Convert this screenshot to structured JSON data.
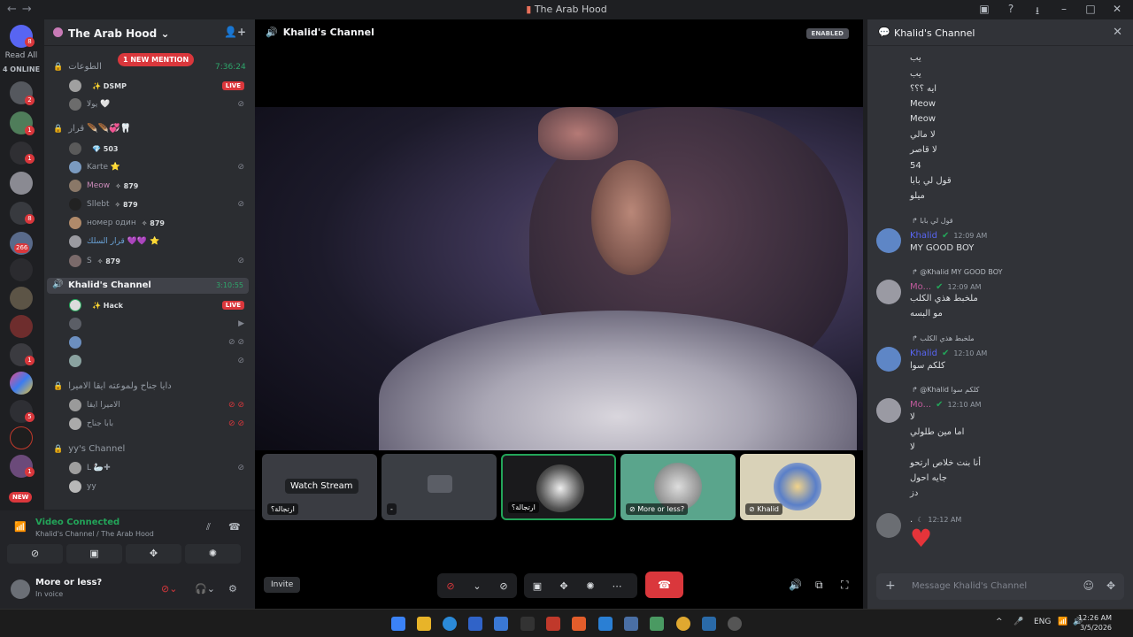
{
  "titlebar": {
    "title": "The Arab Hood",
    "back": "←",
    "forward": "→"
  },
  "rail": {
    "read_all": "Read All",
    "online": "4 ONLINE",
    "new_label": "NEW",
    "badges": [
      "8",
      "2",
      "1",
      "1",
      "8",
      "266",
      "1",
      "1",
      "5"
    ]
  },
  "server": {
    "name": "The Arab Hood"
  },
  "sidebar": {
    "new_mention": "1 NEW MENTION",
    "categories": [
      {
        "name": "الطوعات",
        "time": "7:36:24"
      },
      {
        "name": "قرار 🪶🪶💞🦷"
      },
      {
        "name": "Khalid's Channel",
        "time": "3:10:55"
      },
      {
        "name": "دايا جناح ولموعته ايقا الاميرا"
      },
      {
        "name": "yy's Channel"
      }
    ],
    "users": [
      {
        "name": "",
        "tag": "✨ DSMP",
        "live": "LIVE"
      },
      {
        "name": "يولا 🤍",
        "tag": ""
      },
      {
        "name": "",
        "tag": "💎 503"
      },
      {
        "name": "Karte ⭐",
        "tag": ""
      },
      {
        "name": "Meow",
        "tag": "✧ 879"
      },
      {
        "name": "Sllebt",
        "tag": "✧ 879"
      },
      {
        "name": "номер один",
        "tag": "✧ 879"
      },
      {
        "name": "قرار السلك 💜💜 ⭐",
        "tag": ""
      },
      {
        "name": "S",
        "tag": "✧ 879"
      },
      {
        "name": "",
        "tag": "✨ Hack",
        "live": "LIVE"
      },
      {
        "name": "",
        "tag": ""
      },
      {
        "name": "",
        "tag": ""
      },
      {
        "name": "",
        "tag": ""
      },
      {
        "name": "الاميرا ايقا",
        "tag": ""
      },
      {
        "name": "بابا جناح",
        "tag": ""
      },
      {
        "name": "L 🦢✚",
        "tag": ""
      },
      {
        "name": "yy",
        "tag": ""
      }
    ]
  },
  "voice": {
    "status": "Video Connected",
    "location": "Khalid's Channel / The Arab Hood"
  },
  "user": {
    "name": "More or less?",
    "status": "In voice"
  },
  "stage": {
    "channel": "Khalid's Channel",
    "enabled": "ENABLED",
    "tiles": [
      {
        "label": "ارتجالة؟",
        "overlay": "Watch Stream"
      },
      {
        "label": "-"
      },
      {
        "label": "ارتجالة؟"
      },
      {
        "label": "More or less?"
      },
      {
        "label": "Khalid"
      }
    ],
    "invite": "Invite"
  },
  "chat": {
    "title": "Khalid's Channel",
    "lines_top": [
      "يب",
      "يب",
      "ايه ؟؟؟",
      "Meow",
      "Meow",
      "لا مالي",
      "لا قاصر",
      "54",
      "قول لي بابا",
      "ميلو"
    ],
    "messages": [
      {
        "reply": "قول لي بابا",
        "author": "Khalid",
        "time": "12:09 AM",
        "lines": [
          "MY GOOD BOY"
        ]
      },
      {
        "reply": "@Khalid MY GOOD BOY",
        "author": "Mo...",
        "time": "12:09 AM",
        "lines": [
          "ملخبط هذي الكلب",
          "مو البسه"
        ]
      },
      {
        "reply": "ملخبط هذي الكلب",
        "author": "Khalid",
        "time": "12:10 AM",
        "lines": [
          "كلكم سوا"
        ]
      },
      {
        "reply": "@Khalid كلكم سوا",
        "author": "Mo...",
        "time": "12:10 AM",
        "lines": [
          "لا",
          "اما مين طلولي",
          "لا",
          "أنا بنت خلاص ارتحو",
          "جايه احول",
          "دز"
        ]
      },
      {
        "reply": "",
        "author": ".",
        "time": "12:12 AM",
        "lines": []
      }
    ],
    "input_placeholder": "Message Khalid's Channel"
  },
  "taskbar": {
    "lang": "ENG",
    "time": "12:26 AM",
    "date": "3/5/2026"
  },
  "colors": {
    "accent": "#5865f2",
    "live": "#da373c",
    "voice_green": "#23a559"
  }
}
